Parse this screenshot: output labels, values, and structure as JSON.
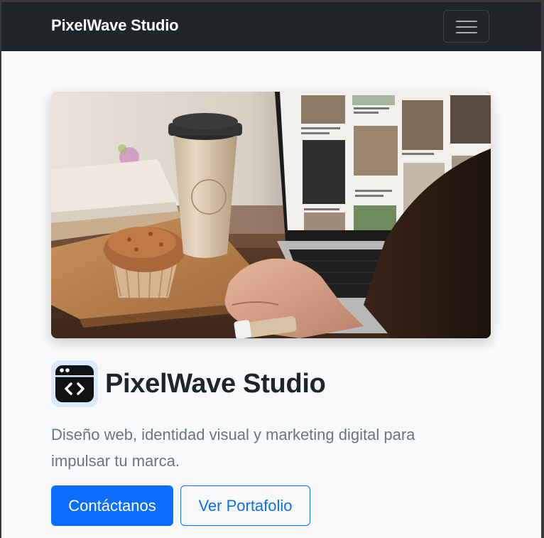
{
  "navbar": {
    "brand": "PixelWave Studio",
    "menu_icon": "hamburger-menu-icon"
  },
  "hero": {
    "image_icon": "hero-photo",
    "logo_icon": "code-window-icon",
    "title": "PixelWave Studio",
    "lead": "Diseño web, identidad visual y marketing digital para impulsar tu marca."
  },
  "actions": {
    "primary_label": "Contáctanos",
    "secondary_label": "Ver Portafolio"
  },
  "colors": {
    "navbar_bg": "#212529",
    "page_bg": "#f8f9fa",
    "primary": "#0d6efd",
    "text_dark": "#212529",
    "text_muted": "#6c757d"
  }
}
